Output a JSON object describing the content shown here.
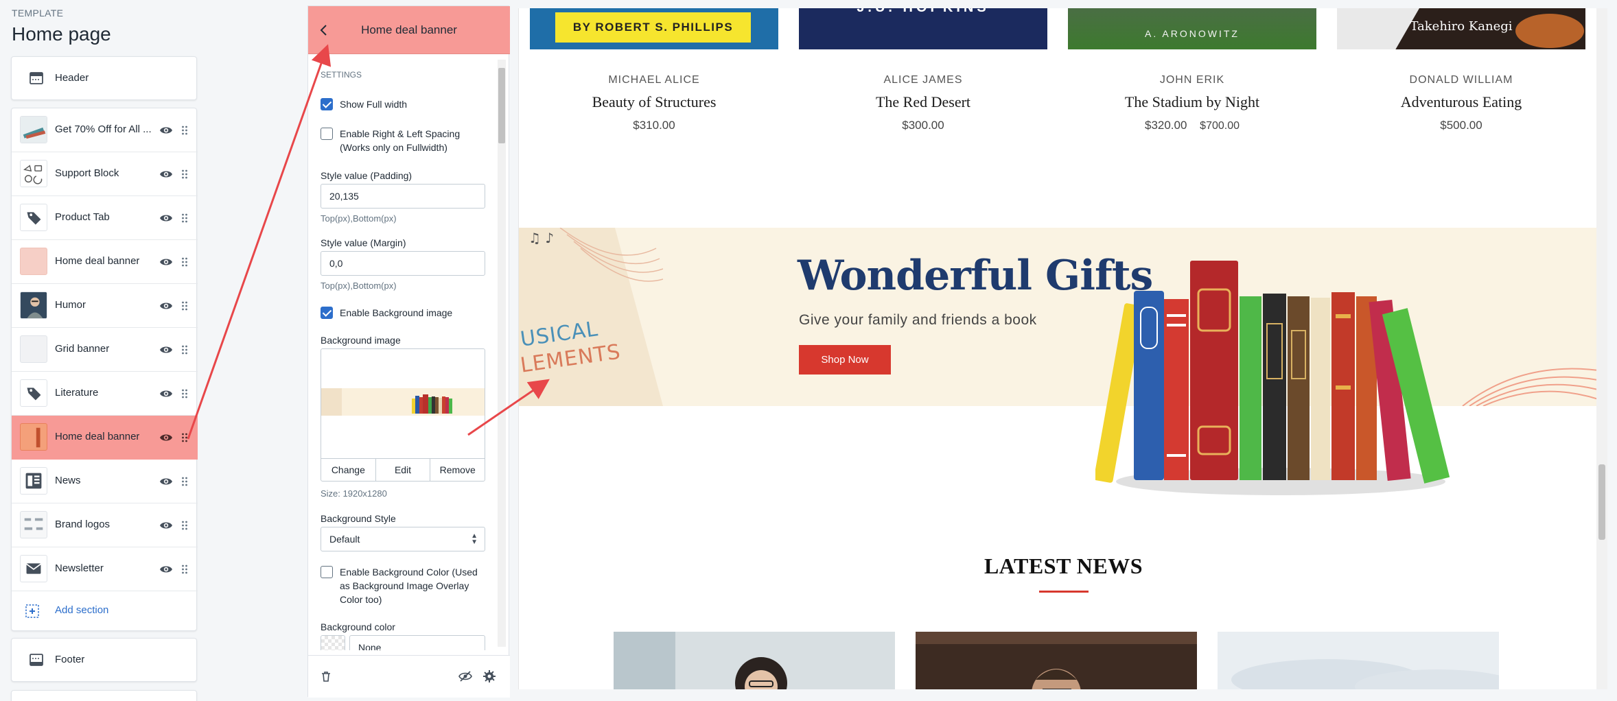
{
  "sidebar": {
    "template_caption": "TEMPLATE",
    "title": "Home page",
    "header_label": "Header",
    "sections": [
      {
        "label": "Get 70% Off for All ...",
        "thumb": "books-thumb"
      },
      {
        "label": "Support Block",
        "thumb": "support-thumb"
      },
      {
        "label": "Product Tab",
        "thumb": "tag-icon"
      },
      {
        "label": "Home deal banner",
        "thumb": "pink-thumb"
      },
      {
        "label": "Humor",
        "thumb": "person-thumb"
      },
      {
        "label": "Grid banner",
        "thumb": "blank-thumb"
      },
      {
        "label": "Literature",
        "thumb": "tag-icon"
      },
      {
        "label": "Home deal banner",
        "thumb": "orange-thumb",
        "selected": true
      },
      {
        "label": "News",
        "thumb": "news-icon"
      },
      {
        "label": "Brand logos",
        "thumb": "logos-thumb"
      },
      {
        "label": "Newsletter",
        "thumb": "mail-icon"
      }
    ],
    "add_section": "Add section",
    "footer_label": "Footer",
    "highlight_color": "#f79a96",
    "link_color": "#2c6ecb"
  },
  "panel": {
    "title": "Home deal banner",
    "settings_caption": "SETTINGS",
    "show_full_width": {
      "label": "Show Full width",
      "checked": true
    },
    "enable_spacing": {
      "label_1": "Enable Right & Left Spacing",
      "label_2": "(Works only on Fullwidth)",
      "checked": false
    },
    "padding": {
      "label": "Style value (Padding)",
      "value": "20,135",
      "hint": "Top(px),Bottom(px)"
    },
    "margin": {
      "label": "Style value (Margin)",
      "value": "0,0",
      "hint": "Top(px),Bottom(px)"
    },
    "enable_bg_image": {
      "label": "Enable Background image",
      "checked": true
    },
    "bg_image": {
      "label": "Background image",
      "change": "Change",
      "edit": "Edit",
      "remove": "Remove",
      "size": "Size: 1920x1280"
    },
    "bg_style": {
      "label": "Background Style",
      "value": "Default"
    },
    "enable_bg_color": {
      "label_1": "Enable Background Color (Used",
      "label_2": "as Background Image Overlay",
      "label_3": "Color too)",
      "checked": false
    },
    "bg_color": {
      "label": "Background color",
      "value": "None"
    }
  },
  "preview": {
    "products": [
      {
        "author": "MICHAEL ALICE",
        "title": "Beauty of Structures",
        "price": "$310.00",
        "compare_price": "",
        "cover_text": "BY ROBERT S. PHILLIPS"
      },
      {
        "author": "ALICE JAMES",
        "title": "The Red Desert",
        "price": "$300.00",
        "compare_price": "",
        "cover_text": "J.U. HOPKINS"
      },
      {
        "author": "JOHN ERIK",
        "title": "The Stadium by Night",
        "price": "$320.00",
        "compare_price": "$700.00",
        "cover_text": "A. ARONOWITZ"
      },
      {
        "author": "DONALD WILLIAM",
        "title": "Adventurous Eating",
        "price": "$500.00",
        "compare_price": "",
        "cover_text": "Takehiro Kanegi"
      }
    ],
    "banner": {
      "title": "Wonderful Gifts",
      "subtitle": "Give your family and friends a book",
      "button": "Shop Now",
      "side_text_1": "USICAL",
      "side_text_2": "LEMENTS",
      "title_color": "#1f3b6e",
      "button_color": "#d7382e",
      "bg_color": "#faf3e3"
    },
    "news_title": "LATEST NEWS",
    "accent_color": "#d7382e"
  }
}
